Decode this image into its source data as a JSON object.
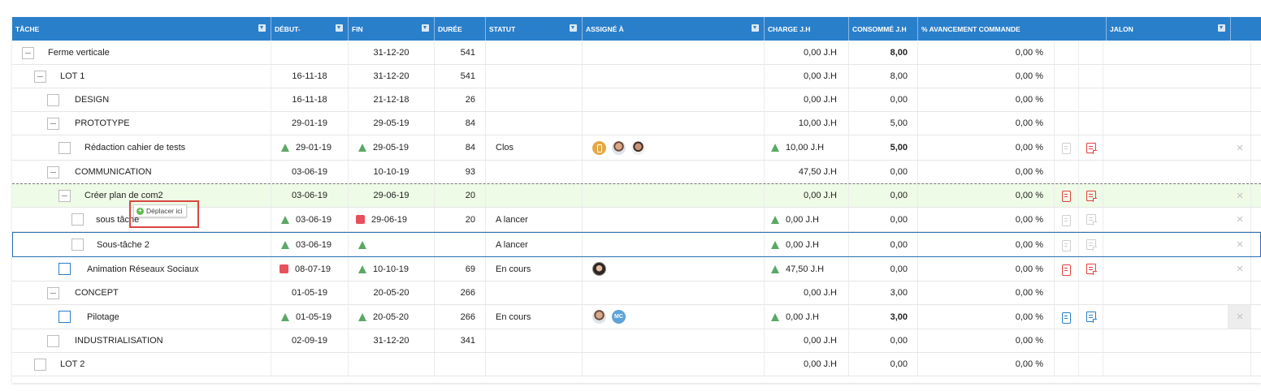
{
  "columns": {
    "tache": "Tâche",
    "debut": "Début-",
    "fin": "Fin",
    "duree": "Durée",
    "statut": "Statut",
    "assigne": "Assigné à",
    "charge": "Charge J.H",
    "consomme": "Consommé J.H",
    "avancement": "% Avancement commande",
    "jalon": "Jalon"
  },
  "rows": [
    {
      "name": "Ferme verticale",
      "debut": "",
      "fin": "31-12-20",
      "duree": "541",
      "statut": "",
      "charge": "0,00 J.H",
      "consomme": "8,00",
      "avancement": "0,00 %"
    },
    {
      "name": "LOT 1",
      "debut": "16-11-18",
      "fin": "31-12-20",
      "duree": "541",
      "statut": "",
      "charge": "0,00 J.H",
      "consomme": "8,00",
      "avancement": "0,00 %"
    },
    {
      "name": "DESIGN",
      "debut": "16-11-18",
      "fin": "21-12-18",
      "duree": "26",
      "statut": "",
      "charge": "0,00 J.H",
      "consomme": "0,00",
      "avancement": "0,00 %"
    },
    {
      "name": "PROTOTYPE",
      "debut": "29-01-19",
      "fin": "29-05-19",
      "duree": "84",
      "statut": "",
      "charge": "10,00 J.H",
      "consomme": "5,00",
      "avancement": "0,00 %"
    },
    {
      "name": "Rédaction cahier de tests",
      "debut": "29-01-19",
      "fin": "29-05-19",
      "duree": "84",
      "statut": "Clos",
      "charge": "10,00 J.H",
      "consomme": "5,00",
      "avancement": "0,00 %"
    },
    {
      "name": "COMMUNICATION",
      "debut": "03-06-19",
      "fin": "10-10-19",
      "duree": "93",
      "statut": "",
      "charge": "47,50 J.H",
      "consomme": "0,00",
      "avancement": "0,00 %"
    },
    {
      "name": "Créer plan de com2",
      "debut": "03-06-19",
      "fin": "29-06-19",
      "duree": "20",
      "statut": "",
      "charge": "0,00 J.H",
      "consomme": "0,00",
      "avancement": "0,00 %"
    },
    {
      "name": "sous tâche",
      "debut": "03-06-19",
      "fin": "29-06-19",
      "duree": "20",
      "statut": "A lancer",
      "charge": "0,00 J.H",
      "consomme": "0,00",
      "avancement": "0,00 %"
    },
    {
      "name": "Sous-tâche 2",
      "debut": "03-06-19",
      "fin": "",
      "duree": "",
      "statut": "A lancer",
      "charge": "0,00 J.H",
      "consomme": "0,00",
      "avancement": "0,00 %"
    },
    {
      "name": "Animation Réseaux Sociaux",
      "debut": "08-07-19",
      "fin": "10-10-19",
      "duree": "69",
      "statut": "En cours",
      "charge": "47,50 J.H",
      "consomme": "0,00",
      "avancement": "0,00 %"
    },
    {
      "name": "CONCEPT",
      "debut": "01-05-19",
      "fin": "20-05-20",
      "duree": "266",
      "statut": "",
      "charge": "0,00 J.H",
      "consomme": "3,00",
      "avancement": "0,00 %"
    },
    {
      "name": "Pilotage",
      "debut": "01-05-19",
      "fin": "20-05-20",
      "duree": "266",
      "statut": "En cours",
      "charge": "0,00 J.H",
      "consomme": "3,00",
      "avancement": "0,00 %"
    },
    {
      "name": "INDUSTRIALISATION",
      "debut": "02-09-19",
      "fin": "31-12-20",
      "duree": "341",
      "statut": "",
      "charge": "0,00 J.H",
      "consomme": "0,00",
      "avancement": "0,00 %"
    },
    {
      "name": "LOT 2",
      "debut": "",
      "fin": "",
      "duree": "",
      "statut": "",
      "charge": "0,00 J.H",
      "consomme": "0,00",
      "avancement": "0,00 %"
    }
  ],
  "avatars": {
    "mc_initials": "MC"
  },
  "tooltip": {
    "label": "Déplacer ici",
    "icon": "plus-circle-icon"
  },
  "icons": {
    "row_close": "×"
  },
  "colors": {
    "header_bg": "#2a7fcb",
    "ok_triangle": "#5aa865",
    "late_square": "#e8505b",
    "drop_row_bg": "#eefbe6",
    "highlight_border": "#d9473f"
  }
}
